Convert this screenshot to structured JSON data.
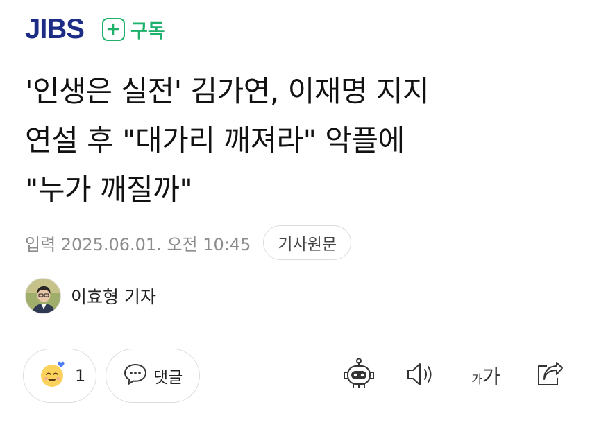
{
  "header": {
    "logo": "JIBS",
    "subscribe_icon": "plus-icon",
    "subscribe_label": "구독",
    "accent_color": "#1fb06b",
    "logo_color": "#1d2d86"
  },
  "article": {
    "title_lines": [
      "'인생은 실전' 김가연, 이재명 지지",
      "연설 후 \"대가리 깨져라\" 악플에",
      "\"누가 깨질까\""
    ],
    "date": "입력 2025.06.01. 오전 10:45",
    "source_button": "기사원문"
  },
  "author": {
    "avatar_icon": "reporter-avatar",
    "name": "이효형 기자"
  },
  "actions": {
    "like_icon": "smile-emoji-icon",
    "like_count": "1",
    "comment_icon": "speech-bubble-icon",
    "comment_label": "댓글",
    "tools": [
      {
        "icon": "robot-summary-icon"
      },
      {
        "icon": "speaker-icon"
      },
      {
        "icon": "font-size-icon",
        "small": "가",
        "big": "가"
      },
      {
        "icon": "share-icon"
      }
    ]
  }
}
